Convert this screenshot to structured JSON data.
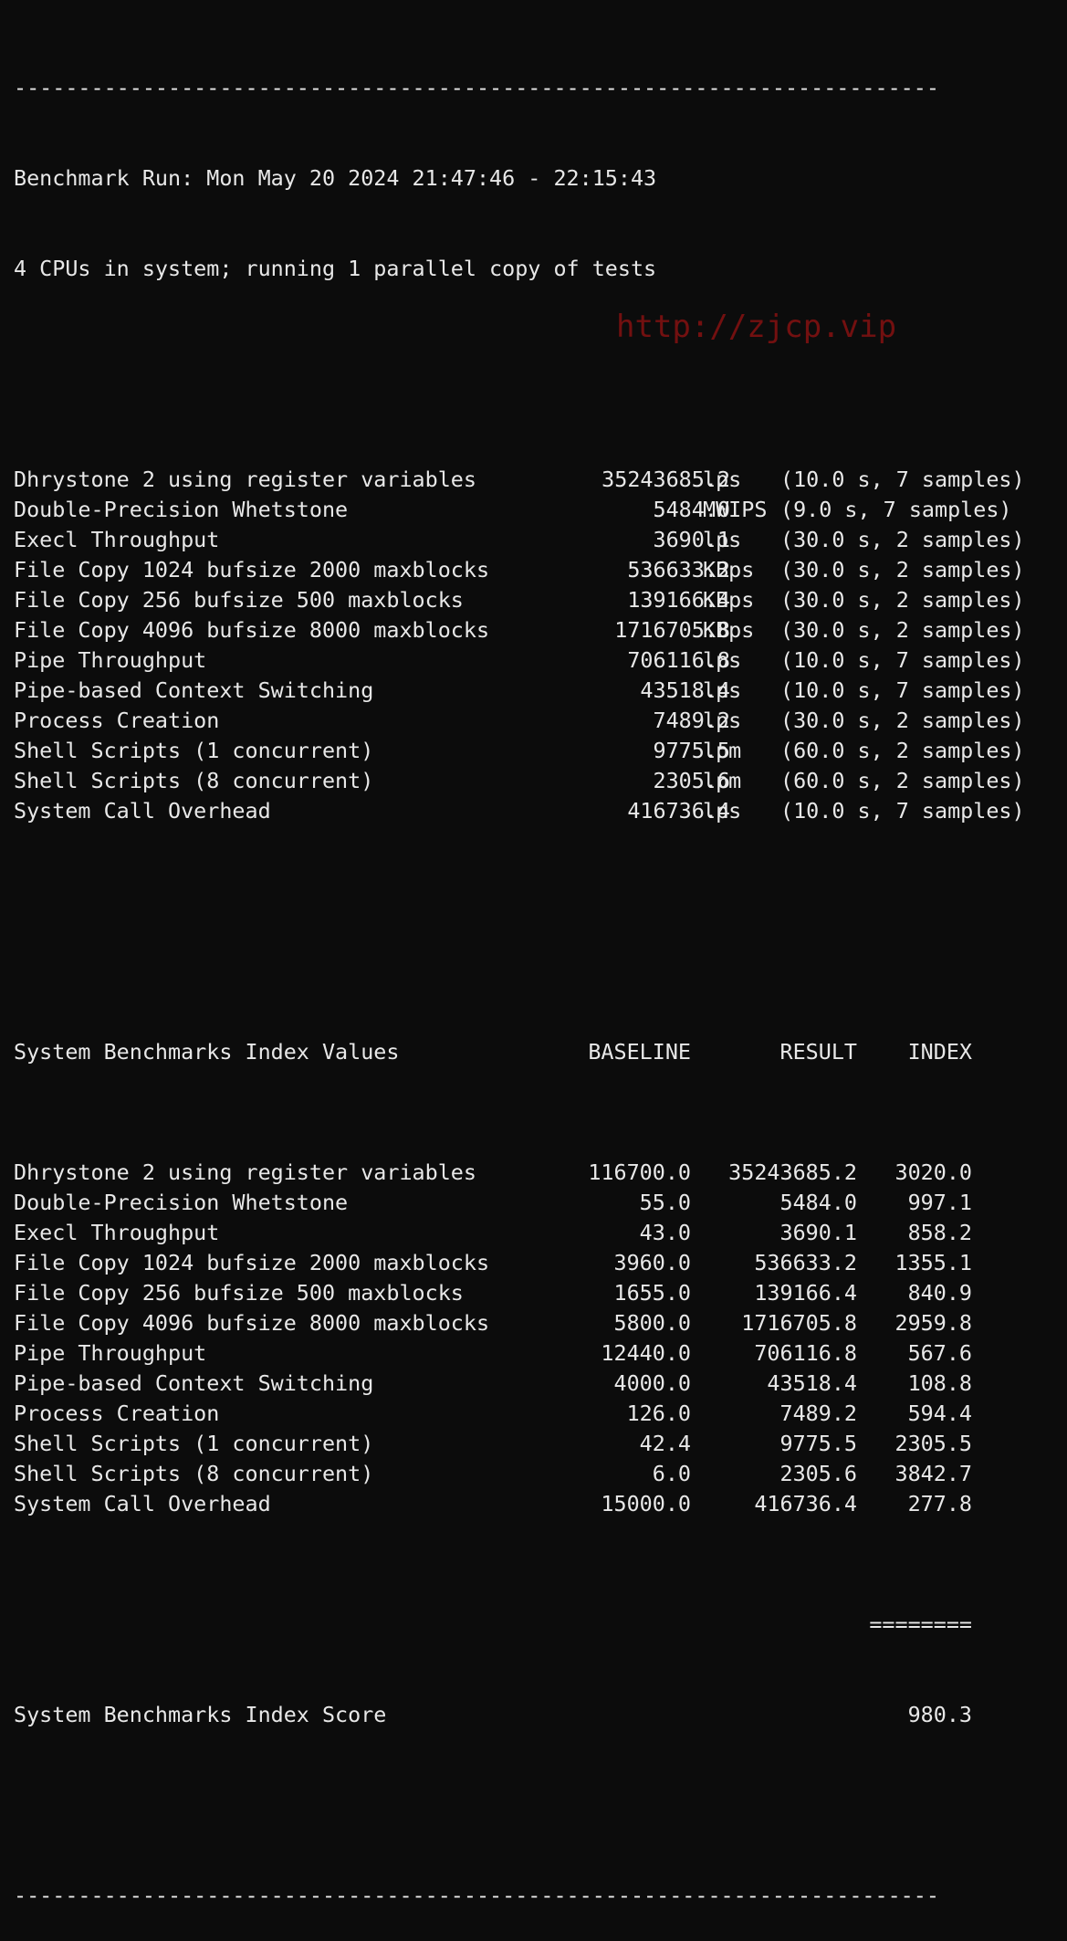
{
  "terminal": {
    "rule_top": "------------------------------------------------------------------------",
    "run_line": "Benchmark Run: Mon May 20 2024 21:47:46 - 22:15:43",
    "cpu_line": "4 CPUs in system; running 1 parallel copy of tests",
    "results": [
      {
        "name": "Dhrystone 2 using register variables",
        "value": "35243685.2",
        "unit": "lps",
        "timing": "(10.0 s, 7 samples)"
      },
      {
        "name": "Double-Precision Whetstone",
        "value": "5484.0",
        "unit": "MWIPS",
        "timing": "(9.0 s, 7 samples)"
      },
      {
        "name": "Execl Throughput",
        "value": "3690.1",
        "unit": "lps",
        "timing": "(30.0 s, 2 samples)"
      },
      {
        "name": "File Copy 1024 bufsize 2000 maxblocks",
        "value": "536633.2",
        "unit": "KBps",
        "timing": "(30.0 s, 2 samples)"
      },
      {
        "name": "File Copy 256 bufsize 500 maxblocks",
        "value": "139166.4",
        "unit": "KBps",
        "timing": "(30.0 s, 2 samples)"
      },
      {
        "name": "File Copy 4096 bufsize 8000 maxblocks",
        "value": "1716705.8",
        "unit": "KBps",
        "timing": "(30.0 s, 2 samples)"
      },
      {
        "name": "Pipe Throughput",
        "value": "706116.8",
        "unit": "lps",
        "timing": "(10.0 s, 7 samples)"
      },
      {
        "name": "Pipe-based Context Switching",
        "value": "43518.4",
        "unit": "lps",
        "timing": "(10.0 s, 7 samples)"
      },
      {
        "name": "Process Creation",
        "value": "7489.2",
        "unit": "lps",
        "timing": "(30.0 s, 2 samples)"
      },
      {
        "name": "Shell Scripts (1 concurrent)",
        "value": "9775.5",
        "unit": "lpm",
        "timing": "(60.0 s, 2 samples)"
      },
      {
        "name": "Shell Scripts (8 concurrent)",
        "value": "2305.6",
        "unit": "lpm",
        "timing": "(60.0 s, 2 samples)"
      },
      {
        "name": "System Call Overhead",
        "value": "416736.4",
        "unit": "lps",
        "timing": "(10.0 s, 7 samples)"
      }
    ],
    "index_header": {
      "title": "System Benchmarks Index Values",
      "baseline": "BASELINE",
      "result": "RESULT",
      "index": "INDEX"
    },
    "index_rows": [
      {
        "name": "Dhrystone 2 using register variables",
        "baseline": "116700.0",
        "result": "35243685.2",
        "index": "3020.0"
      },
      {
        "name": "Double-Precision Whetstone",
        "baseline": "55.0",
        "result": "5484.0",
        "index": "997.1"
      },
      {
        "name": "Execl Throughput",
        "baseline": "43.0",
        "result": "3690.1",
        "index": "858.2"
      },
      {
        "name": "File Copy 1024 bufsize 2000 maxblocks",
        "baseline": "3960.0",
        "result": "536633.2",
        "index": "1355.1"
      },
      {
        "name": "File Copy 256 bufsize 500 maxblocks",
        "baseline": "1655.0",
        "result": "139166.4",
        "index": "840.9"
      },
      {
        "name": "File Copy 4096 bufsize 8000 maxblocks",
        "baseline": "5800.0",
        "result": "1716705.8",
        "index": "2959.8"
      },
      {
        "name": "Pipe Throughput",
        "baseline": "12440.0",
        "result": "706116.8",
        "index": "567.6"
      },
      {
        "name": "Pipe-based Context Switching",
        "baseline": "4000.0",
        "result": "43518.4",
        "index": "108.8"
      },
      {
        "name": "Process Creation",
        "baseline": "126.0",
        "result": "7489.2",
        "index": "594.4"
      },
      {
        "name": "Shell Scripts (1 concurrent)",
        "baseline": "42.4",
        "result": "9775.5",
        "index": "2305.5"
      },
      {
        "name": "Shell Scripts (8 concurrent)",
        "baseline": "6.0",
        "result": "2305.6",
        "index": "3842.7"
      },
      {
        "name": "System Call Overhead",
        "baseline": "15000.0",
        "result": "416736.4",
        "index": "277.8"
      }
    ],
    "score_rule": "========",
    "score_label": "System Benchmarks Index Score",
    "score_value": "980.3",
    "rule_bottom": "------------------------------------------------------------------------"
  },
  "watermark": {
    "text": "http://zjcp.vip"
  },
  "colors": {
    "background": "#0c0c0c",
    "foreground": "#e8e8e8",
    "watermark": "#c81414"
  }
}
